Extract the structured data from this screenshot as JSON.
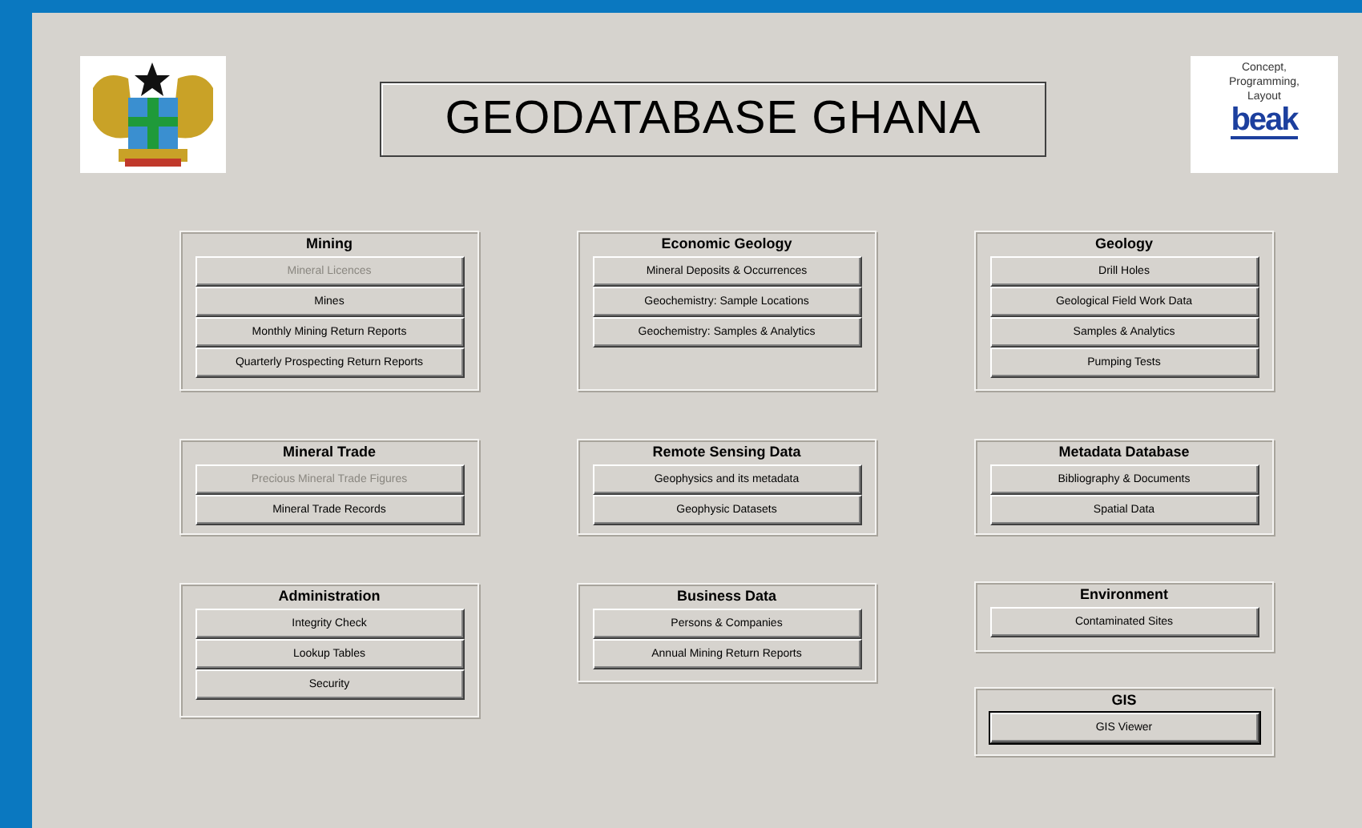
{
  "title": "GEODATABASE GHANA",
  "credit": {
    "lines": [
      "Concept,",
      "Programming,",
      "Layout"
    ],
    "brand": "beak"
  },
  "columns": [
    [
      {
        "title": "Mining",
        "buttons": [
          {
            "label": "Mineral Licences",
            "disabled": true
          },
          {
            "label": "Mines",
            "disabled": false
          },
          {
            "label": "Monthly Mining Return Reports",
            "disabled": false
          },
          {
            "label": "Quarterly Prospecting Return Reports",
            "disabled": false
          }
        ]
      },
      {
        "title": "Mineral Trade",
        "buttons": [
          {
            "label": "Precious Mineral Trade Figures",
            "disabled": true
          },
          {
            "label": "Mineral Trade Records",
            "disabled": false
          }
        ]
      },
      {
        "title": "Administration",
        "buttons": [
          {
            "label": "Integrity Check",
            "disabled": false
          },
          {
            "label": "Lookup Tables",
            "disabled": false
          },
          {
            "label": "Security",
            "disabled": false
          }
        ]
      }
    ],
    [
      {
        "title": "Economic Geology",
        "buttons": [
          {
            "label": "Mineral Deposits & Occurrences",
            "disabled": false
          },
          {
            "label": "Geochemistry: Sample Locations",
            "disabled": false
          },
          {
            "label": "Geochemistry: Samples & Analytics",
            "disabled": false
          }
        ]
      },
      {
        "title": "Remote Sensing Data",
        "buttons": [
          {
            "label": "Geophysics and its metadata",
            "disabled": false
          },
          {
            "label": "Geophysic Datasets",
            "disabled": false
          }
        ]
      },
      {
        "title": "Business Data",
        "buttons": [
          {
            "label": "Persons & Companies",
            "disabled": false
          },
          {
            "label": "Annual Mining Return Reports",
            "disabled": false
          }
        ]
      }
    ],
    [
      {
        "title": "Geology",
        "buttons": [
          {
            "label": "Drill Holes",
            "disabled": false
          },
          {
            "label": "Geological Field Work Data",
            "disabled": false
          },
          {
            "label": "Samples & Analytics",
            "disabled": false
          },
          {
            "label": "Pumping Tests",
            "disabled": false
          }
        ]
      },
      {
        "title": "Metadata Database",
        "buttons": [
          {
            "label": "Bibliography & Documents",
            "disabled": false
          },
          {
            "label": "Spatial Data",
            "disabled": false
          }
        ]
      },
      {
        "title": "Environment",
        "buttons": [
          {
            "label": "Contaminated Sites",
            "disabled": false
          }
        ]
      },
      {
        "title": "GIS",
        "buttons": [
          {
            "label": "GIS Viewer",
            "disabled": false,
            "focused": true
          }
        ]
      }
    ]
  ]
}
